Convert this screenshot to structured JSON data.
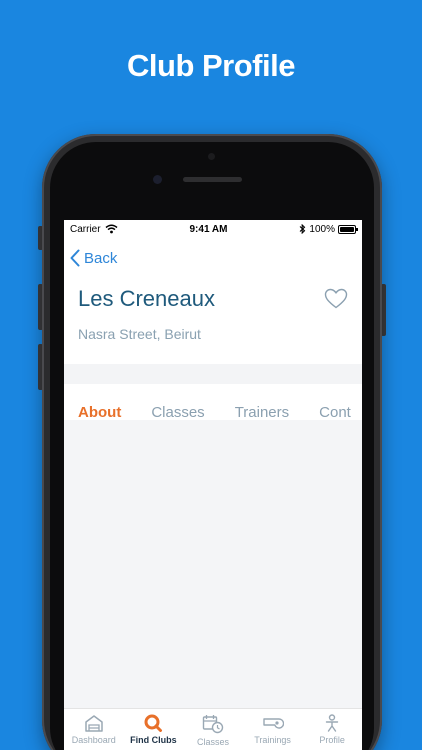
{
  "headline": "Club Profile",
  "status_bar": {
    "carrier": "Carrier",
    "time": "9:41 AM",
    "battery": "100%"
  },
  "nav": {
    "back_label": "Back"
  },
  "club": {
    "name": "Les Creneaux",
    "address": "Nasra Street, Beirut"
  },
  "tabs": [
    {
      "label": "About",
      "active": true
    },
    {
      "label": "Classes",
      "active": false
    },
    {
      "label": "Trainers",
      "active": false
    },
    {
      "label": "Cont",
      "active": false
    }
  ],
  "tab_bar": [
    {
      "label": "Dashboard",
      "icon": "home-icon",
      "active": false
    },
    {
      "label": "Find Clubs",
      "icon": "search-icon",
      "active": true
    },
    {
      "label": "Classes",
      "icon": "calendar-clock-icon",
      "active": false
    },
    {
      "label": "Trainings",
      "icon": "whistle-icon",
      "active": false
    },
    {
      "label": "Profile",
      "icon": "person-icon",
      "active": false
    }
  ],
  "colors": {
    "background": "#1a86e0",
    "accent": "#e8702a",
    "link": "#2e86d8",
    "title": "#1f5a7c"
  }
}
